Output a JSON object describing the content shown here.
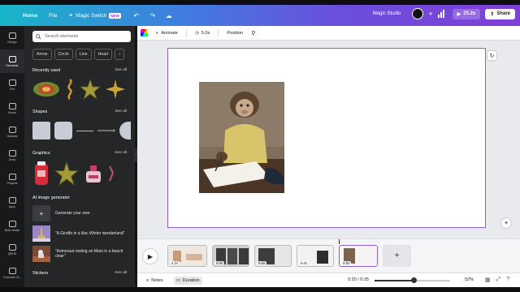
{
  "header": {
    "home": "Home",
    "file": "File",
    "magic_switch": "Magic Switch",
    "new_badge": "NEW",
    "magic_studio": "Magic Studio",
    "duration": "25.2s",
    "share": "Share"
  },
  "rail": {
    "items": [
      {
        "label": "Design"
      },
      {
        "label": "Elements"
      },
      {
        "label": "Text"
      },
      {
        "label": "Brand"
      },
      {
        "label": "Uploads"
      },
      {
        "label": "Draw"
      },
      {
        "label": "Projects"
      },
      {
        "label": "Apps"
      },
      {
        "label": "Bulk create"
      },
      {
        "label": "QRGS"
      },
      {
        "label": "Character B..."
      }
    ]
  },
  "panel": {
    "search_placeholder": "Search elements",
    "chips": [
      "Arrow",
      "Circle",
      "Line",
      "Heart"
    ],
    "recently_used": "Recently used",
    "shapes": "Shapes",
    "graphics": "Graphics",
    "see_all": "See all",
    "ai_generator": "AI image generator",
    "generate_own": "Generate your own",
    "prompt_1": "\"A Giraffe in a lilac Winter wonderland\"",
    "prompt_2": "\"Astronaut resting on Mars in a beach chair\"",
    "stickers": "Stickers"
  },
  "toolbar": {
    "animate": "Animate",
    "duration": "5.0s",
    "position": "Position"
  },
  "timeline": {
    "clips": [
      {
        "dur": "5.2s"
      },
      {
        "dur": "5.0s"
      },
      {
        "dur": "5.0s"
      },
      {
        "dur": "5.0s"
      },
      {
        "dur": "5.0s"
      }
    ]
  },
  "footer": {
    "notes": "Notes",
    "duration": "Duration",
    "time": "0:20 / 0:25",
    "zoom": "52%",
    "zoom_level": 0.52
  },
  "colors": {
    "accent": "#8c5fd8",
    "header_start": "#19b6c9",
    "header_end": "#7e3fd8"
  }
}
